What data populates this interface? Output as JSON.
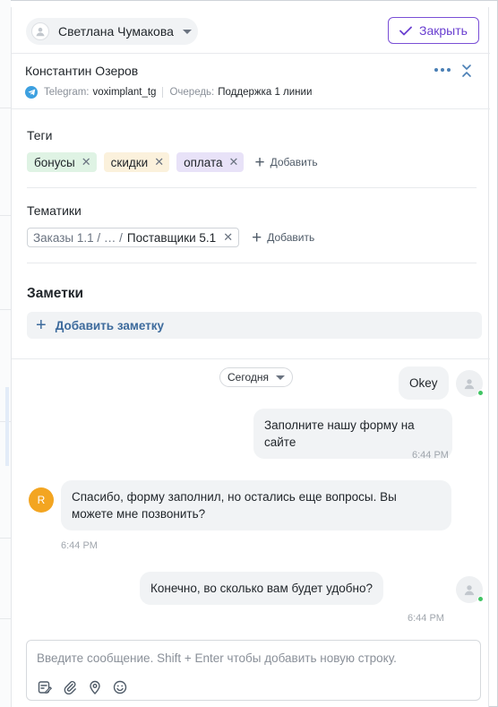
{
  "header": {
    "agent_name": "Светлана Чумакова",
    "close_label": "Закрыть"
  },
  "contact": {
    "name": "Константин Озеров",
    "channel_label": "Telegram:",
    "channel_value": "voximplant_tg",
    "queue_label": "Очередь:",
    "queue_value": "Поддержка 1 линии"
  },
  "tags": {
    "title": "Теги",
    "items": [
      {
        "label": "бонусы",
        "color": "#dff3e4"
      },
      {
        "label": "скидки",
        "color": "#fbf1dc"
      },
      {
        "label": "оплата",
        "color": "#e8e2f8"
      }
    ],
    "add_label": "Добавить"
  },
  "topics": {
    "title": "Тематики",
    "path_prefix": "Заказы 1.1 / … /",
    "path_last": "Поставщики 5.1",
    "add_label": "Добавить"
  },
  "notes": {
    "title": "Заметки",
    "add_label": "Добавить заметку"
  },
  "chat": {
    "date_label": "Сегодня",
    "messages": [
      {
        "from": "operator",
        "text": "Okey",
        "time": ""
      },
      {
        "from": "operator",
        "text": "Заполните нашу форму на сайте",
        "time": "6:44 PM"
      },
      {
        "from": "client",
        "initial": "R",
        "text": "Спасибо, форму заполнил, но остались еще вопросы. Вы можете мне позвонить?",
        "time": "6:44 PM"
      },
      {
        "from": "operator",
        "text": "Конечно, во сколько вам будет удобно?",
        "time": "6:44 PM"
      }
    ]
  },
  "composer": {
    "placeholder": "Введите сообщение. Shift + Enter чтобы добавить новую строку."
  },
  "colors": {
    "accent": "#6a3fd0",
    "link": "#3c6a9c",
    "online": "#41c463",
    "client_avatar": "#f3a521"
  }
}
